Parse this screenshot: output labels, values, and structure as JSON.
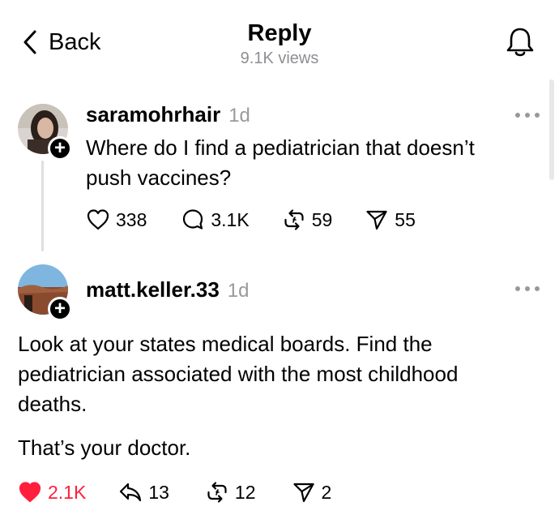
{
  "header": {
    "back_label": "Back",
    "title": "Reply",
    "views": "9.1K views"
  },
  "posts": [
    {
      "username": "saramohrhair",
      "time": "1d",
      "text_lines": [
        "Where do I find a pediatrician that doesn’t",
        "push vaccines?"
      ],
      "likes": "338",
      "replies": "3.1K",
      "reposts": "59",
      "shares": "55",
      "liked": false
    },
    {
      "username": "matt.keller.33",
      "time": "1d",
      "text_lines": [
        "Look at your states medical boards.  Find the",
        "pediatrician associated with the most childhood",
        "deaths."
      ],
      "text_line_2": "That’s your doctor.",
      "likes": "2.1K",
      "replies": "13",
      "reposts": "12",
      "shares": "2",
      "liked": true
    }
  ],
  "colors": {
    "liked": "#ff1f3d",
    "muted": "#9a9a9a"
  },
  "icons": [
    "chevron-left-icon",
    "bell-icon",
    "plus-icon",
    "more-icon",
    "heart-icon",
    "comment-icon",
    "reply-icon",
    "repost-icon",
    "share-icon"
  ]
}
